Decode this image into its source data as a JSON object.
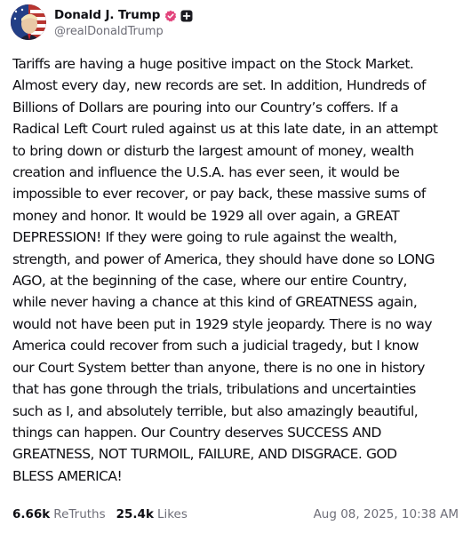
{
  "author": {
    "display_name": "Donald J. Trump",
    "handle": "@realDonaldTrump",
    "verified_color": "#e2447c"
  },
  "post": {
    "lines": [
      "Tariffs are having a huge positive impact on the Stock Market.",
      "Almost every day, new records are set. In addition, Hundreds of",
      "Billions of Dollars are pouring into our Country’s coffers. If a",
      "Radical Left Court ruled against us at this late date, in an attempt",
      "to bring down or disturb the largest amount of money, wealth",
      "creation and influence the U.S.A. has ever seen, it would be",
      "impossible to ever recover, or pay back, these massive sums of",
      "money and honor. It would be 1929 all over again, a GREAT",
      "DEPRESSION! If they were going to rule against the wealth,",
      "strength, and power of America, they should have done so LONG",
      "AGO, at the beginning of the case, where our entire Country,",
      "while never having a chance at this kind of GREATNESS again,",
      "would not have been put in 1929 style jeopardy. There is no way",
      "America could recover from such a judicial tragedy, but I know",
      "our Court System better than anyone, there is no one in history",
      "that has gone through the trials, tribulations and uncertainties",
      "such as I, and absolutely terrible, but also amazingly beautiful,",
      "things can happen. Our Country deserves SUCCESS AND",
      "GREATNESS, NOT TURMOIL, FAILURE, AND DISGRACE. GOD",
      "BLESS AMERICA!"
    ]
  },
  "stats": {
    "retruths_count": "6.66k",
    "retruths_label": "ReTruths",
    "likes_count": "25.4k",
    "likes_label": "Likes",
    "timestamp": "Aug 08, 2025, 10:38 AM"
  }
}
